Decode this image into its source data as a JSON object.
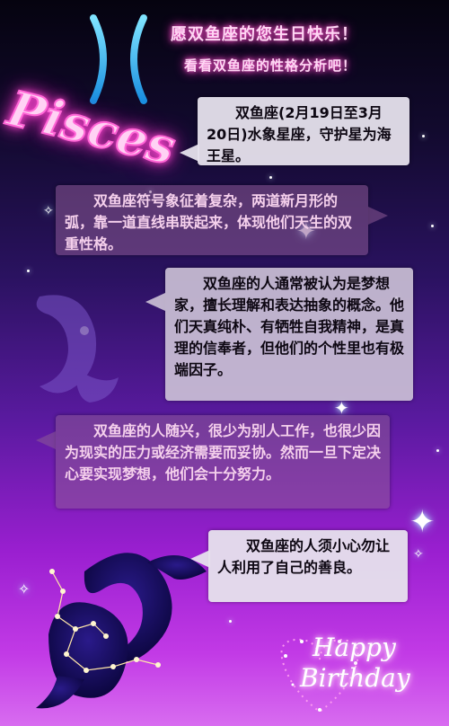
{
  "header": {
    "line1": "愿双鱼座的您生日快乐！",
    "line2": "看看双鱼座的性格分析吧！"
  },
  "logo": {
    "word": "Pisces",
    "symbol_icon": "pisces-zodiac-symbol"
  },
  "bubbles": [
    {
      "text": "双鱼座(2月19日至3月20日)水象星座，守护星为海王星。"
    },
    {
      "text": "双鱼座符号象征着复杂，两道新月形的弧，靠一道直线串联起来，体现他们天生的双重性格。"
    },
    {
      "text": "双鱼座的人通常被认为是梦想家，擅长理解和表达抽象的概念。他们天真纯朴、有牺牲自我精神，是真理的信奉者，但他们的个性里也有极端因子。"
    },
    {
      "text": "双鱼座的人随兴，很少为别人工作，也很少因为现实的压力或经济需要而妥协。然而一旦下定决心要实现梦想，他们会十分努力。"
    },
    {
      "text": "双鱼座的人须小心勿让人利用了自己的善良。"
    }
  ],
  "greeting": {
    "line1": "Happy",
    "line2": "Birthday"
  },
  "colors": {
    "neon_pink": "#ff48d0",
    "symbol_cyan": "#2ec9ff",
    "bg_top": "#05030f",
    "bg_bottom": "#d86cf0"
  }
}
